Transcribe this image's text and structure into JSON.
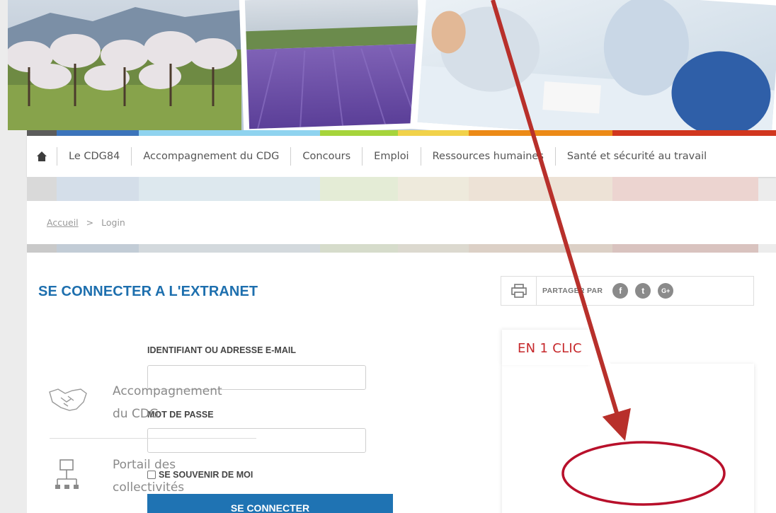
{
  "nav": {
    "items": [
      {
        "label": "Le CDG84"
      },
      {
        "label": "Accompagnement du CDG"
      },
      {
        "label": "Concours"
      },
      {
        "label": "Emploi"
      },
      {
        "label": "Ressources humaines"
      },
      {
        "label": "Santé et sécurité au travail"
      }
    ]
  },
  "breadcrumb": {
    "home": "Accueil",
    "separator": ">",
    "current": "Login"
  },
  "login": {
    "title": "SE CONNECTER A L'EXTRANET",
    "username_label": "IDENTIFIANT OU ADRESSE E-MAIL",
    "username_value": "",
    "password_label": "MOT DE PASSE",
    "password_value": "",
    "remember_label": "SE SOUVENIR DE MOI",
    "submit_label": "SE CONNECTER"
  },
  "share": {
    "label": "PARTAGER PAR",
    "facebook": "f",
    "twitter": "t",
    "google": "G+"
  },
  "en_un_clic": {
    "title": "EN 1 CLIC",
    "items": [
      {
        "line1": "Accompagnement",
        "line2": "du CDG",
        "icon": "handshake-icon"
      },
      {
        "line1": "Portail des",
        "line2": "collectivités",
        "icon": "network-icon"
      }
    ]
  },
  "colors": {
    "accent_blue": "#1f73b3",
    "accent_red": "#c6282b",
    "annotation": "#b8302b",
    "stripe": [
      "#5c5c5c",
      "#3c74bb",
      "#8fd3ef",
      "#a6d43b",
      "#f1d24a",
      "#ec8a16",
      "#d1361e"
    ]
  }
}
